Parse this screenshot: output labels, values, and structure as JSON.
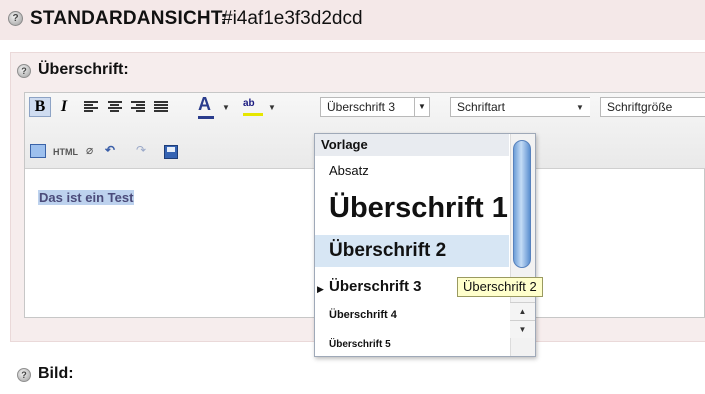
{
  "header": {
    "title": "STANDARDANSICHT:",
    "id": "#i4af1e3f3d2dcd"
  },
  "section": {
    "label": "Überschrift:"
  },
  "toolbar": {
    "bold": "B",
    "italic": "I",
    "text_color": "A",
    "highlight": "ab",
    "format_select": "Überschrift 3",
    "font_select": "Schriftart",
    "size_select": "Schriftgröße",
    "html_label": "HTML"
  },
  "editor": {
    "content": "Das ist ein Test"
  },
  "dropdown": {
    "header": "Vorlage",
    "items": [
      {
        "label": "Absatz"
      },
      {
        "label": "Überschrift 1"
      },
      {
        "label": "Überschrift 2"
      },
      {
        "label": "Überschrift 3"
      },
      {
        "label": "Überschrift 4"
      },
      {
        "label": "Überschrift 5"
      }
    ],
    "selected": "Überschrift 3",
    "hovered": "Überschrift 2"
  },
  "tooltip": {
    "text": "Überschrift 2"
  },
  "footer_section": {
    "label": "Bild:"
  },
  "icons": {
    "section_icon": "help-circle-icon",
    "undo": "undo-icon",
    "redo": "redo-icon",
    "save": "save-icon",
    "eraser": "eraser-icon"
  },
  "colors": {
    "header_bg": "#f4e8e8",
    "selection": "#d7e6f4",
    "tooltip_bg": "#ffffcc",
    "scroll_thumb": "#6e9fd8"
  }
}
